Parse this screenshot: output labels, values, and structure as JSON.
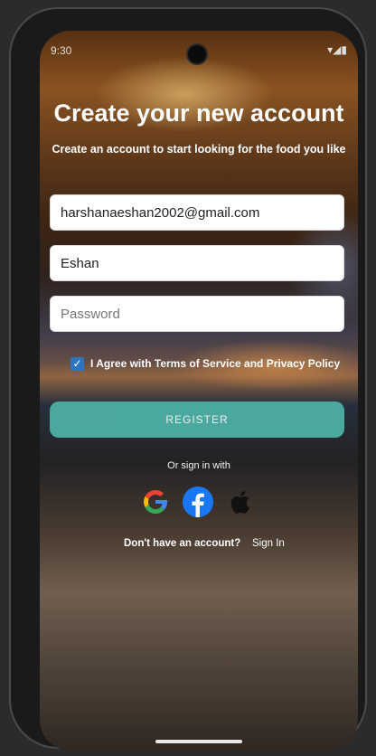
{
  "status_bar": {
    "time": "9:30",
    "icons": "▾◢▮"
  },
  "header": {
    "title": "Create your new account",
    "subtitle": "Create an account to start looking for the food you like"
  },
  "form": {
    "email_value": "harshanaeshan2002@gmail.com",
    "name_value": "Eshan",
    "password_placeholder": "Password",
    "agree_checked": true,
    "agree_label": "I Agree with Terms of Service and Privacy Policy",
    "register_label": "REGISTER"
  },
  "social": {
    "or_text": "Or sign in with",
    "providers": [
      "google-icon",
      "facebook-icon",
      "apple-icon"
    ]
  },
  "footer": {
    "no_account_text": "Don't have an account?",
    "signin_label": "Sign In"
  },
  "colors": {
    "register_button": "#4fb3a7",
    "checkbox": "#2f74c0",
    "facebook": "#1877f2"
  }
}
